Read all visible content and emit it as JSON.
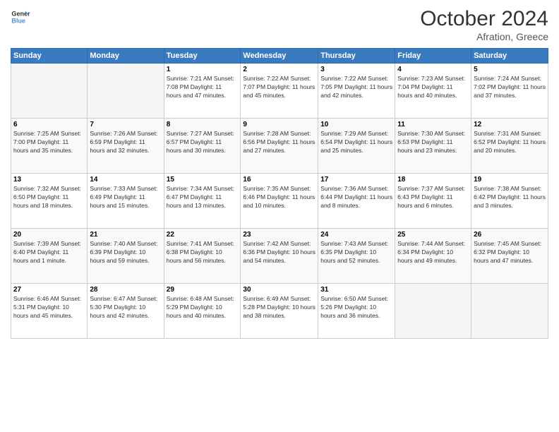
{
  "header": {
    "logo_general": "General",
    "logo_blue": "Blue",
    "month_year": "October 2024",
    "location": "Afration, Greece"
  },
  "weekdays": [
    "Sunday",
    "Monday",
    "Tuesday",
    "Wednesday",
    "Thursday",
    "Friday",
    "Saturday"
  ],
  "weeks": [
    [
      {
        "day": "",
        "info": ""
      },
      {
        "day": "",
        "info": ""
      },
      {
        "day": "1",
        "info": "Sunrise: 7:21 AM\nSunset: 7:08 PM\nDaylight: 11 hours\nand 47 minutes."
      },
      {
        "day": "2",
        "info": "Sunrise: 7:22 AM\nSunset: 7:07 PM\nDaylight: 11 hours\nand 45 minutes."
      },
      {
        "day": "3",
        "info": "Sunrise: 7:22 AM\nSunset: 7:05 PM\nDaylight: 11 hours\nand 42 minutes."
      },
      {
        "day": "4",
        "info": "Sunrise: 7:23 AM\nSunset: 7:04 PM\nDaylight: 11 hours\nand 40 minutes."
      },
      {
        "day": "5",
        "info": "Sunrise: 7:24 AM\nSunset: 7:02 PM\nDaylight: 11 hours\nand 37 minutes."
      }
    ],
    [
      {
        "day": "6",
        "info": "Sunrise: 7:25 AM\nSunset: 7:00 PM\nDaylight: 11 hours\nand 35 minutes."
      },
      {
        "day": "7",
        "info": "Sunrise: 7:26 AM\nSunset: 6:59 PM\nDaylight: 11 hours\nand 32 minutes."
      },
      {
        "day": "8",
        "info": "Sunrise: 7:27 AM\nSunset: 6:57 PM\nDaylight: 11 hours\nand 30 minutes."
      },
      {
        "day": "9",
        "info": "Sunrise: 7:28 AM\nSunset: 6:56 PM\nDaylight: 11 hours\nand 27 minutes."
      },
      {
        "day": "10",
        "info": "Sunrise: 7:29 AM\nSunset: 6:54 PM\nDaylight: 11 hours\nand 25 minutes."
      },
      {
        "day": "11",
        "info": "Sunrise: 7:30 AM\nSunset: 6:53 PM\nDaylight: 11 hours\nand 23 minutes."
      },
      {
        "day": "12",
        "info": "Sunrise: 7:31 AM\nSunset: 6:52 PM\nDaylight: 11 hours\nand 20 minutes."
      }
    ],
    [
      {
        "day": "13",
        "info": "Sunrise: 7:32 AM\nSunset: 6:50 PM\nDaylight: 11 hours\nand 18 minutes."
      },
      {
        "day": "14",
        "info": "Sunrise: 7:33 AM\nSunset: 6:49 PM\nDaylight: 11 hours\nand 15 minutes."
      },
      {
        "day": "15",
        "info": "Sunrise: 7:34 AM\nSunset: 6:47 PM\nDaylight: 11 hours\nand 13 minutes."
      },
      {
        "day": "16",
        "info": "Sunrise: 7:35 AM\nSunset: 6:46 PM\nDaylight: 11 hours\nand 10 minutes."
      },
      {
        "day": "17",
        "info": "Sunrise: 7:36 AM\nSunset: 6:44 PM\nDaylight: 11 hours\nand 8 minutes."
      },
      {
        "day": "18",
        "info": "Sunrise: 7:37 AM\nSunset: 6:43 PM\nDaylight: 11 hours\nand 6 minutes."
      },
      {
        "day": "19",
        "info": "Sunrise: 7:38 AM\nSunset: 6:42 PM\nDaylight: 11 hours\nand 3 minutes."
      }
    ],
    [
      {
        "day": "20",
        "info": "Sunrise: 7:39 AM\nSunset: 6:40 PM\nDaylight: 11 hours\nand 1 minute."
      },
      {
        "day": "21",
        "info": "Sunrise: 7:40 AM\nSunset: 6:39 PM\nDaylight: 10 hours\nand 59 minutes."
      },
      {
        "day": "22",
        "info": "Sunrise: 7:41 AM\nSunset: 6:38 PM\nDaylight: 10 hours\nand 56 minutes."
      },
      {
        "day": "23",
        "info": "Sunrise: 7:42 AM\nSunset: 6:36 PM\nDaylight: 10 hours\nand 54 minutes."
      },
      {
        "day": "24",
        "info": "Sunrise: 7:43 AM\nSunset: 6:35 PM\nDaylight: 10 hours\nand 52 minutes."
      },
      {
        "day": "25",
        "info": "Sunrise: 7:44 AM\nSunset: 6:34 PM\nDaylight: 10 hours\nand 49 minutes."
      },
      {
        "day": "26",
        "info": "Sunrise: 7:45 AM\nSunset: 6:32 PM\nDaylight: 10 hours\nand 47 minutes."
      }
    ],
    [
      {
        "day": "27",
        "info": "Sunrise: 6:46 AM\nSunset: 5:31 PM\nDaylight: 10 hours\nand 45 minutes."
      },
      {
        "day": "28",
        "info": "Sunrise: 6:47 AM\nSunset: 5:30 PM\nDaylight: 10 hours\nand 42 minutes."
      },
      {
        "day": "29",
        "info": "Sunrise: 6:48 AM\nSunset: 5:29 PM\nDaylight: 10 hours\nand 40 minutes."
      },
      {
        "day": "30",
        "info": "Sunrise: 6:49 AM\nSunset: 5:28 PM\nDaylight: 10 hours\nand 38 minutes."
      },
      {
        "day": "31",
        "info": "Sunrise: 6:50 AM\nSunset: 5:26 PM\nDaylight: 10 hours\nand 36 minutes."
      },
      {
        "day": "",
        "info": ""
      },
      {
        "day": "",
        "info": ""
      }
    ]
  ]
}
